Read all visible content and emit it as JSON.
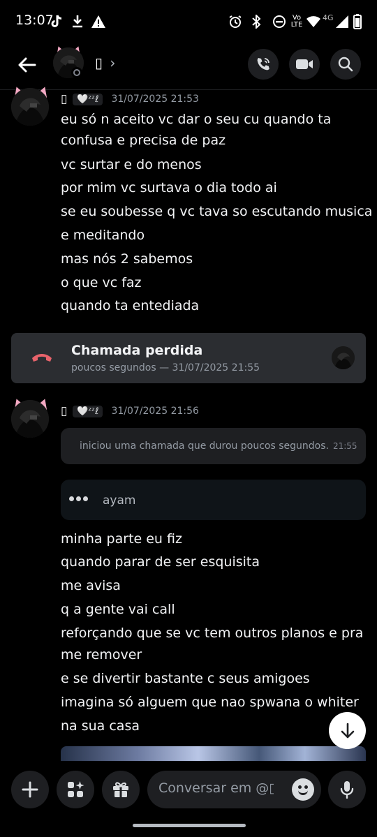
{
  "status_bar": {
    "time": "13:07",
    "network": "4G",
    "volte": "Vo LTE"
  },
  "header": {
    "contact_name": "▯",
    "chevron": "›"
  },
  "messages": [
    {
      "author": "▯",
      "tag": "🤍ᶻᶻℓ",
      "timestamp": "31/07/2025 21:53",
      "lines": [
        "eu só n aceito vc dar o seu cu quando ta",
        "confusa e precisa de paz",
        "vc surtar e do menos",
        "por mim vc surtava o dia todo ai",
        "se eu soubesse q vc tava so escutando musica",
        "e meditando",
        "mas nós 2 sabemos",
        "o que vc faz",
        "quando ta entediada"
      ]
    },
    {
      "author": "▯",
      "tag": "🤍ᶻᶻℓ",
      "timestamp": "31/07/2025 21:56",
      "lines": [
        "minha parte eu fiz",
        "quando parar de ser esquisita",
        "me avisa",
        "q a gente vai call",
        "reforçando que se vc tem outros planos e pra",
        "me remover",
        "e se divertir bastante c seus amigoes",
        "imagina só alguem que nao spwana o whiter",
        "na sua casa"
      ]
    }
  ],
  "missed_call": {
    "title": "Chamada perdida",
    "subtitle": "poucos segundos — 31/07/2025 21:55"
  },
  "system_message": {
    "text": "iniciou uma chamada que durou poucos segundos.",
    "time": "21:55"
  },
  "reply": {
    "name": "ayam"
  },
  "composer": {
    "placeholder": "Conversar em @▯"
  },
  "colors": {
    "background": "#000000",
    "card": "#2b2d31",
    "missed_call_red": "#e8636b",
    "muted_text": "#949ba4"
  },
  "icons": [
    "back-arrow-icon",
    "call-icon",
    "video-icon",
    "search-icon",
    "phone-hangup-icon",
    "chevron-down-icon",
    "plus-icon",
    "apps-icon",
    "gift-icon",
    "emoji-icon",
    "microphone-icon"
  ]
}
